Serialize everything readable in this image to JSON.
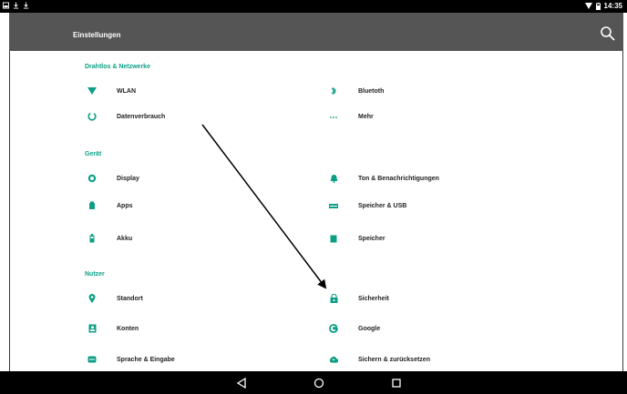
{
  "status_bar": {
    "time": "14:35",
    "left_icons": [
      "image-icon",
      "download-icon",
      "download-icon"
    ],
    "right_icons": [
      "wifi-icon",
      "battery-icon"
    ]
  },
  "app_bar": {
    "title": "Einstellungen",
    "search_icon": "search-icon"
  },
  "sections": [
    {
      "header": "Drahtlos & Netzwerke",
      "items": [
        {
          "label": "WLAN",
          "icon": "wifi-icon"
        },
        {
          "label": "Bluetoth",
          "icon": "bluetooth-icon"
        },
        {
          "label": "Datenverbrauch",
          "icon": "data-usage-icon"
        },
        {
          "label": "Mehr",
          "icon": "more-icon"
        }
      ]
    },
    {
      "header": "Gerät",
      "items": [
        {
          "label": "Display",
          "icon": "brightness-icon"
        },
        {
          "label": "Ton & Benachrichtigungen",
          "icon": "bell-icon"
        },
        {
          "label": "Apps",
          "icon": "android-icon"
        },
        {
          "label": "Speicher & USB",
          "icon": "storage-icon"
        },
        {
          "label": "Akku",
          "icon": "battery-icon"
        },
        {
          "label": "Speicher",
          "icon": "memory-icon"
        }
      ]
    },
    {
      "header": "Nutzer",
      "items": [
        {
          "label": "Standort",
          "icon": "location-icon"
        },
        {
          "label": "Sicherheit",
          "icon": "lock-icon"
        },
        {
          "label": "Konten",
          "icon": "account-icon"
        },
        {
          "label": "Google",
          "icon": "google-icon"
        },
        {
          "label": "Sprache & Eingabe",
          "icon": "language-icon"
        },
        {
          "label": "Sichern & zurücksetzen",
          "icon": "backup-icon"
        }
      ]
    }
  ],
  "nav_bar": [
    "back-icon",
    "home-icon",
    "recents-icon"
  ],
  "colors": {
    "accent": "#0d9f86",
    "app_bar": "#555555",
    "status_bar": "#000000"
  }
}
